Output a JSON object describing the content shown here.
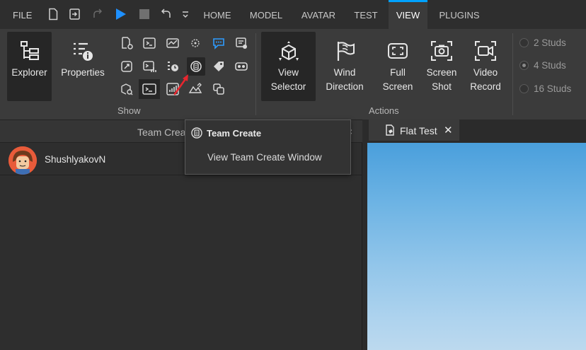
{
  "menu": {
    "file": "FILE",
    "quick_icons": [
      "new-file-icon",
      "open-file-icon",
      "redo-icon",
      "play-icon",
      "stop-icon",
      "undo-icon",
      "dropdown-icon"
    ]
  },
  "tabs": [
    {
      "label": "HOME",
      "active": false
    },
    {
      "label": "MODEL",
      "active": false
    },
    {
      "label": "AVATAR",
      "active": false
    },
    {
      "label": "TEST",
      "active": false
    },
    {
      "label": "VIEW",
      "active": true
    },
    {
      "label": "PLUGINS",
      "active": false
    }
  ],
  "ribbon": {
    "explorer": "Explorer",
    "properties": "Properties",
    "show_label": "Show",
    "actions_label": "Actions",
    "view_selector": [
      "View",
      "Selector"
    ],
    "wind_direction": [
      "Wind",
      "Direction"
    ],
    "full_screen": [
      "Full",
      "Screen"
    ],
    "screen_shot": [
      "Screen",
      "Shot"
    ],
    "video_record": [
      "Video",
      "Record"
    ],
    "studs": [
      {
        "label": "2 Studs",
        "selected": false
      },
      {
        "label": "4 Studs",
        "selected": true
      },
      {
        "label": "16 Studs",
        "selected": false
      }
    ]
  },
  "team_panel": {
    "title": "Team Crea",
    "close": "×",
    "user": "ShushlyakovN"
  },
  "tooltip": {
    "title": "Team Create",
    "description": "View Team Create Window"
  },
  "doc_tab": {
    "label": "Flat Test",
    "close": "✕"
  },
  "colors": {
    "accent": "#00a2ff",
    "play": "#1e90ff",
    "arrow": "#e8262e",
    "avatar": "#e85b3a"
  }
}
